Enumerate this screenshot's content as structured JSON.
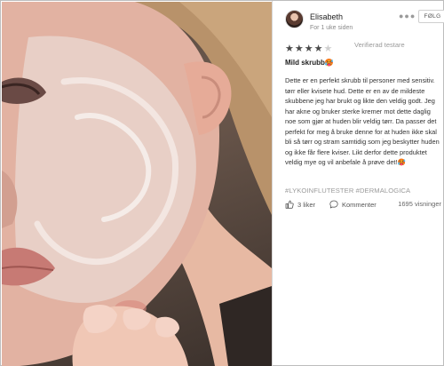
{
  "post": {
    "author": "Elisabeth",
    "time": "For 1 uke siden",
    "more_icon": "more-dots-icon",
    "follow_label": "FØLG"
  },
  "review": {
    "rating": 4,
    "max_rating": 5,
    "verified_label": "Verifierad testare",
    "title": "Mild skrubb",
    "title_emoji": "🥵",
    "body": "Dette er en perfekt skrubb til personer med sensitiv. tørr eller kvisete hud. Dette er en av de mildeste skubbene jeg har brukt og likte den veldig godt. Jeg har akne og bruker sterke kremer mot dette daglig noe som gjør at huden blir veldig tørr. Da passer det perfekt for meg å bruke denne for at huden ikke skal bli så tørr og stram samtidig som jeg beskytter huden og ikke får flere kviser. Likt derfor dette produktet veldig mye og vil anbefale å prøve det!",
    "body_emoji": "🥵",
    "hashtags": "#LYKOINFLUTESTER #DERMALOGICA"
  },
  "actions": {
    "likes": "3 liker",
    "comment_label": "Kommenter",
    "views": "1695 visninger"
  },
  "colors": {
    "star_on": "#4a4a4a",
    "star_off": "#cfcfcf",
    "hashtag": "#9a9a9a",
    "accent_emoji": "#d9553b"
  }
}
